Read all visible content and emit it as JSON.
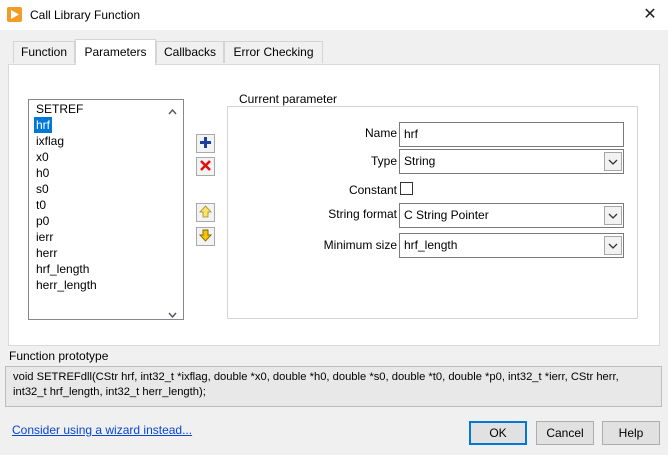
{
  "window": {
    "title": "Call Library Function",
    "close_glyph": "✕"
  },
  "tabs": [
    {
      "label": "Function"
    },
    {
      "label": "Parameters"
    },
    {
      "label": "Callbacks"
    },
    {
      "label": "Error Checking"
    }
  ],
  "parameters_list": {
    "items": [
      "SETREF",
      "hrf",
      "ixflag",
      "x0",
      "h0",
      "s0",
      "t0",
      "p0",
      "ierr",
      "herr",
      "hrf_length",
      "herr_length"
    ],
    "selected": "hrf"
  },
  "side_buttons": {
    "add_icon": "plus-icon",
    "remove_icon": "delete-x-icon",
    "move_up_icon": "arrow-up-icon",
    "move_down_icon": "arrow-down-icon"
  },
  "current_parameter": {
    "group_title": "Current parameter",
    "name_label": "Name",
    "name_value": "hrf",
    "type_label": "Type",
    "type_value": "String",
    "constant_label": "Constant",
    "string_format_label": "String format",
    "string_format_value": "C String Pointer",
    "min_size_label": "Minimum size",
    "min_size_value": "hrf_length"
  },
  "prototype": {
    "label": "Function prototype",
    "line1": "void  SETREFdll(CStr hrf, int32_t *ixflag, double *x0, double *h0, double *s0, double *t0, double *p0, int32_t *ierr, CStr herr,",
    "line2": "int32_t hrf_length, int32_t herr_length);"
  },
  "footer": {
    "wizard_link": "Consider using a wizard instead...",
    "ok_label": "OK",
    "cancel_label": "Cancel",
    "help_label": "Help"
  },
  "colors": {
    "accent": "#0078d7",
    "link": "#0645d6",
    "icon_orange": "#f29b25"
  }
}
